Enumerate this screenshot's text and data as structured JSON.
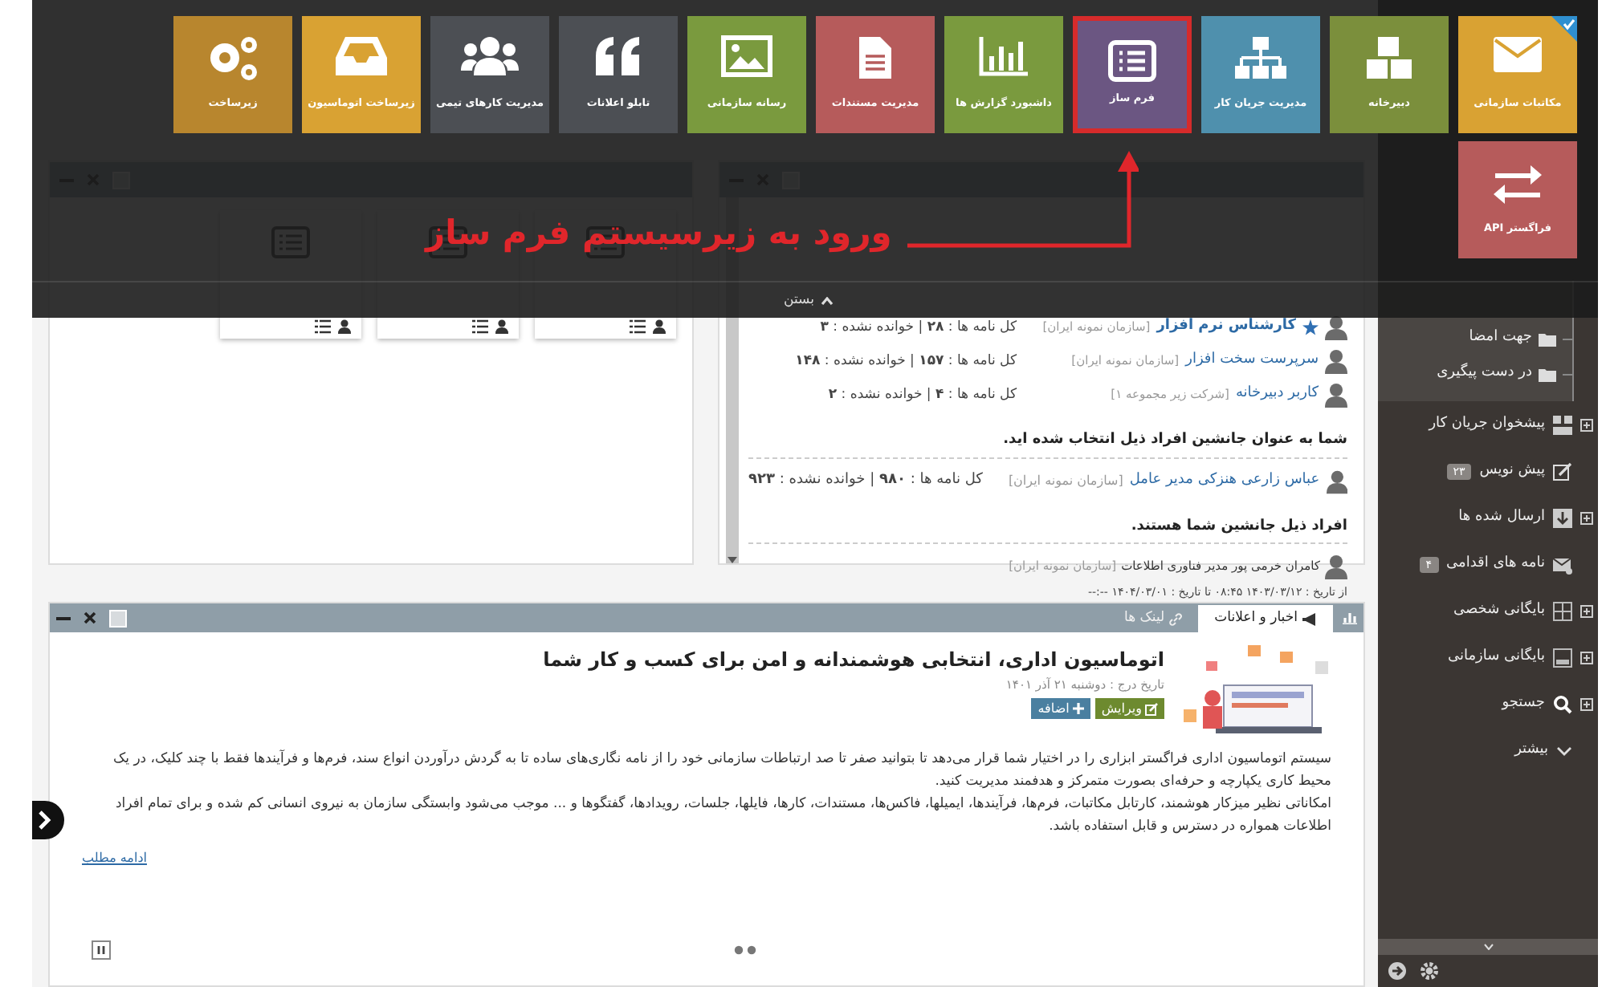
{
  "tiles": [
    {
      "label": "مکاتبات سازمانی",
      "color": "#d9a233",
      "checked": true,
      "highlighted": false
    },
    {
      "label": "دبیرخانه",
      "color": "#7b8f3c",
      "checked": false,
      "highlighted": false
    },
    {
      "label": "مدیریت جریان کار",
      "color": "#4f90ad",
      "checked": false,
      "highlighted": false
    },
    {
      "label": "فرم ساز",
      "color": "#6b5682",
      "checked": false,
      "highlighted": true
    },
    {
      "label": "داشبورد گزارش ها",
      "color": "#7a9a3e",
      "checked": false,
      "highlighted": false
    },
    {
      "label": "مدیریت مستندات",
      "color": "#b65b5b",
      "checked": false,
      "highlighted": false
    },
    {
      "label": "رسانه سازمانی",
      "color": "#7a9a3e",
      "checked": false,
      "highlighted": false
    },
    {
      "label": "تابلو اعلانات",
      "color": "#4c4f54",
      "checked": false,
      "highlighted": false
    },
    {
      "label": "مدیریت کارهای تیمی",
      "color": "#4c4f54",
      "checked": false,
      "highlighted": false
    },
    {
      "label": "زیرساخت اتوماسیون",
      "color": "#d9a233",
      "checked": false,
      "highlighted": false
    },
    {
      "label": "زیرساخت",
      "color": "#b8862e",
      "checked": false,
      "highlighted": false
    },
    {
      "label": "فراگستر API",
      "color": "#b65b5b",
      "checked": false,
      "highlighted": false
    }
  ],
  "annotation": {
    "text": "ورود به زیرسیستم فرم ساز"
  },
  "overlay_close": "بستن",
  "letters_panel": {
    "positions": [
      {
        "name": "کارشناس نرم افزار",
        "org": "[سازمان نمونه ایران]",
        "stats": "کل نامه ها : **۲۸** | خوانده نشده : **۳**",
        "starred": true
      },
      {
        "name": "سرپرست سخت افزار",
        "org": "[سازمان نمونه ایران]",
        "stats": "کل نامه ها : **۱۵۷** | خوانده نشده : **۱۴۸**",
        "starred": false
      },
      {
        "name": "کاربر دبیرخانه",
        "org": "[شرکت زیر مجموعه ۱]",
        "stats": "کل نامه ها : **۴** | خوانده نشده : **۲**",
        "starred": false
      }
    ],
    "deputy_of_heading": "شما به عنوان جانشین افراد ذیل انتخاب شده اید.",
    "deputy_of": [
      {
        "name": "عباس زارعی هنزکی مدیر عامل",
        "org": "[سازمان نمونه ایران]",
        "stats": "کل نامه ها : **۹۸۰** | خوانده نشده : **۹۲۳**"
      }
    ],
    "deputies_heading": "افراد ذیل جانشین شما هستند.",
    "deputies": [
      {
        "name": "کامران خرمی پور مدیر فناوری اطلاعات",
        "org": "[سازمان نمونه ایران]",
        "period": "از تاریخ : ۱۴۰۳/۰۳/۱۲ ۰۸:۴۵ تا تاریخ : ۱۴۰۴/۰۳/۰۱ --:--"
      }
    ]
  },
  "news_panel": {
    "tabs": [
      {
        "label": "اخبار و اعلانات",
        "selected": true
      },
      {
        "label": "لینک ها",
        "selected": false
      }
    ],
    "title": "اتوماسیون اداری، انتخابی هوشمندانه و امن برای کسب و کار شما",
    "date": "تاریخ درج : دوشنبه ۲۱ آذر ۱۴۰۱",
    "buttons": [
      {
        "label": "ویرایش",
        "kind": "edit"
      },
      {
        "label": "اضافه",
        "kind": "add"
      }
    ],
    "paragraphs": [
      "سیستم اتوماسیون اداری فراگستر ابزاری را در اختیار شما قرار می‌دهد تا بتوانید صفر تا صد ارتباطات سازمانی خود را از نامه نگاری‌های ساده تا به گردش درآوردن انواع سند، فرم‌ها و فرآیندها فقط با چند کلیک، در یک محیط کاری یکپارچه و حرفه‌ای بصورت متمرکز و هدفمند مدیریت کنید.",
      "امکاناتی نظیر میزکار هوشمند، کارتابل مکاتبات، فرم‌ها، فرآیندها، ایمیلها، فاکس‌ها، مستندات، کارها، فایلها، جلسات، رویدادها، گفتگوها و ... موجب می‌شود وابستگی سازمان به نیروی انسانی کم شده و برای تمام افراد اطلاعات همواره در دسترس و قابل استفاده باشد."
    ],
    "more_link": "ادامه مطلب"
  },
  "sidebar": {
    "items": [
      {
        "label": "جهت امضا",
        "kind": "folder"
      },
      {
        "label": "در دست پیگیری",
        "kind": "folder"
      },
      {
        "label": "پیشخوان جریان کار",
        "kind": "item",
        "expandable": true
      },
      {
        "label": "پیش نویس",
        "kind": "item",
        "expandable": false,
        "badge": "۲۳"
      },
      {
        "label": "ارسال شده ها",
        "kind": "item",
        "expandable": true
      },
      {
        "label": "نامه های اقدامی",
        "kind": "item",
        "expandable": false,
        "badge": "۴"
      },
      {
        "label": "بایگانی شخصی",
        "kind": "item",
        "expandable": true
      },
      {
        "label": "بایگانی سازمانی",
        "kind": "item",
        "expandable": true
      },
      {
        "label": "جستجو",
        "kind": "item",
        "expandable": true
      },
      {
        "label": "بیشتر",
        "kind": "more"
      }
    ]
  }
}
